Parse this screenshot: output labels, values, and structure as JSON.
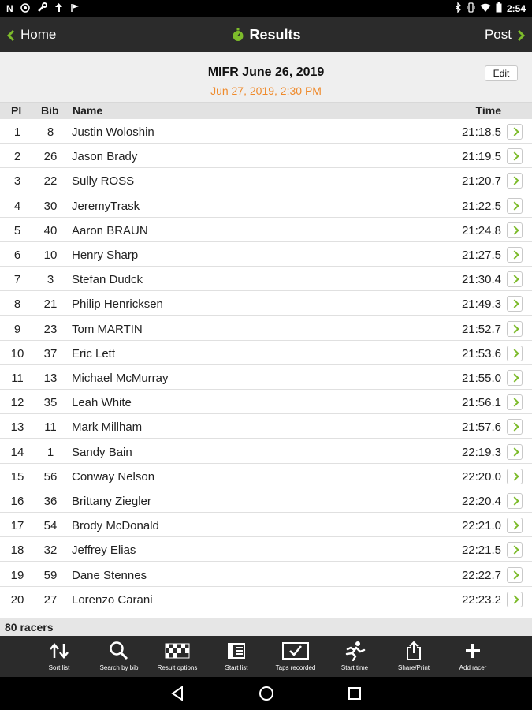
{
  "status_bar": {
    "left_icons": [
      "notification-n-icon",
      "nfc-icon",
      "wrench-icon",
      "upload-icon",
      "flag-icon"
    ],
    "right_icons": [
      "bluetooth-icon",
      "vibrate-icon",
      "wifi-icon",
      "battery-icon"
    ],
    "time": "2:54"
  },
  "navbar": {
    "back_label": "Home",
    "title": "Results",
    "post_label": "Post",
    "accent": "#7dbb2b"
  },
  "event": {
    "title": "MIFR June 26, 2019",
    "date": "Jun 27, 2019, 2:30 PM",
    "edit_label": "Edit",
    "date_color": "#ef8a2b"
  },
  "columns": {
    "pl": "Pl",
    "bib": "Bib",
    "name": "Name",
    "time": "Time"
  },
  "rows": [
    {
      "pl": "1",
      "bib": "8",
      "name": "Justin Woloshin",
      "time": "21:18.5"
    },
    {
      "pl": "2",
      "bib": "26",
      "name": "Jason Brady",
      "time": "21:19.5"
    },
    {
      "pl": "3",
      "bib": "22",
      "name": "Sully ROSS",
      "time": "21:20.7"
    },
    {
      "pl": "4",
      "bib": "30",
      "name": "JeremyTrask",
      "time": "21:22.5"
    },
    {
      "pl": "5",
      "bib": "40",
      "name": "Aaron BRAUN",
      "time": "21:24.8"
    },
    {
      "pl": "6",
      "bib": "10",
      "name": "Henry Sharp",
      "time": "21:27.5"
    },
    {
      "pl": "7",
      "bib": "3",
      "name": "Stefan Dudck",
      "time": "21:30.4"
    },
    {
      "pl": "8",
      "bib": "21",
      "name": "Philip Henricksen",
      "time": "21:49.3"
    },
    {
      "pl": "9",
      "bib": "23",
      "name": "Tom MARTIN",
      "time": "21:52.7"
    },
    {
      "pl": "10",
      "bib": "37",
      "name": "Eric Lett",
      "time": "21:53.6"
    },
    {
      "pl": "11",
      "bib": "13",
      "name": "Michael McMurray",
      "time": "21:55.0"
    },
    {
      "pl": "12",
      "bib": "35",
      "name": "Leah White",
      "time": "21:56.1"
    },
    {
      "pl": "13",
      "bib": "11",
      "name": "Mark Millham",
      "time": "21:57.6"
    },
    {
      "pl": "14",
      "bib": "1",
      "name": "Sandy Bain",
      "time": "22:19.3"
    },
    {
      "pl": "15",
      "bib": "56",
      "name": "Conway Nelson",
      "time": "22:20.0"
    },
    {
      "pl": "16",
      "bib": "36",
      "name": "Brittany Ziegler",
      "time": "22:20.4"
    },
    {
      "pl": "17",
      "bib": "54",
      "name": "Brody McDonald",
      "time": "22:21.0"
    },
    {
      "pl": "18",
      "bib": "32",
      "name": "Jeffrey Elias",
      "time": "22:21.5"
    },
    {
      "pl": "19",
      "bib": "59",
      "name": "Dane Stennes",
      "time": "22:22.7"
    },
    {
      "pl": "20",
      "bib": "27",
      "name": "Lorenzo Carani",
      "time": "22:23.2"
    }
  ],
  "footer": {
    "count": "80 racers"
  },
  "toolbar": {
    "sort": "Sort list",
    "search": "Search by bib",
    "result_options": "Result options",
    "start_list": "Start list",
    "taps_recorded": "Taps recorded",
    "start_time": "Start time",
    "share_print": "Share/Print",
    "add_racer": "Add racer"
  }
}
